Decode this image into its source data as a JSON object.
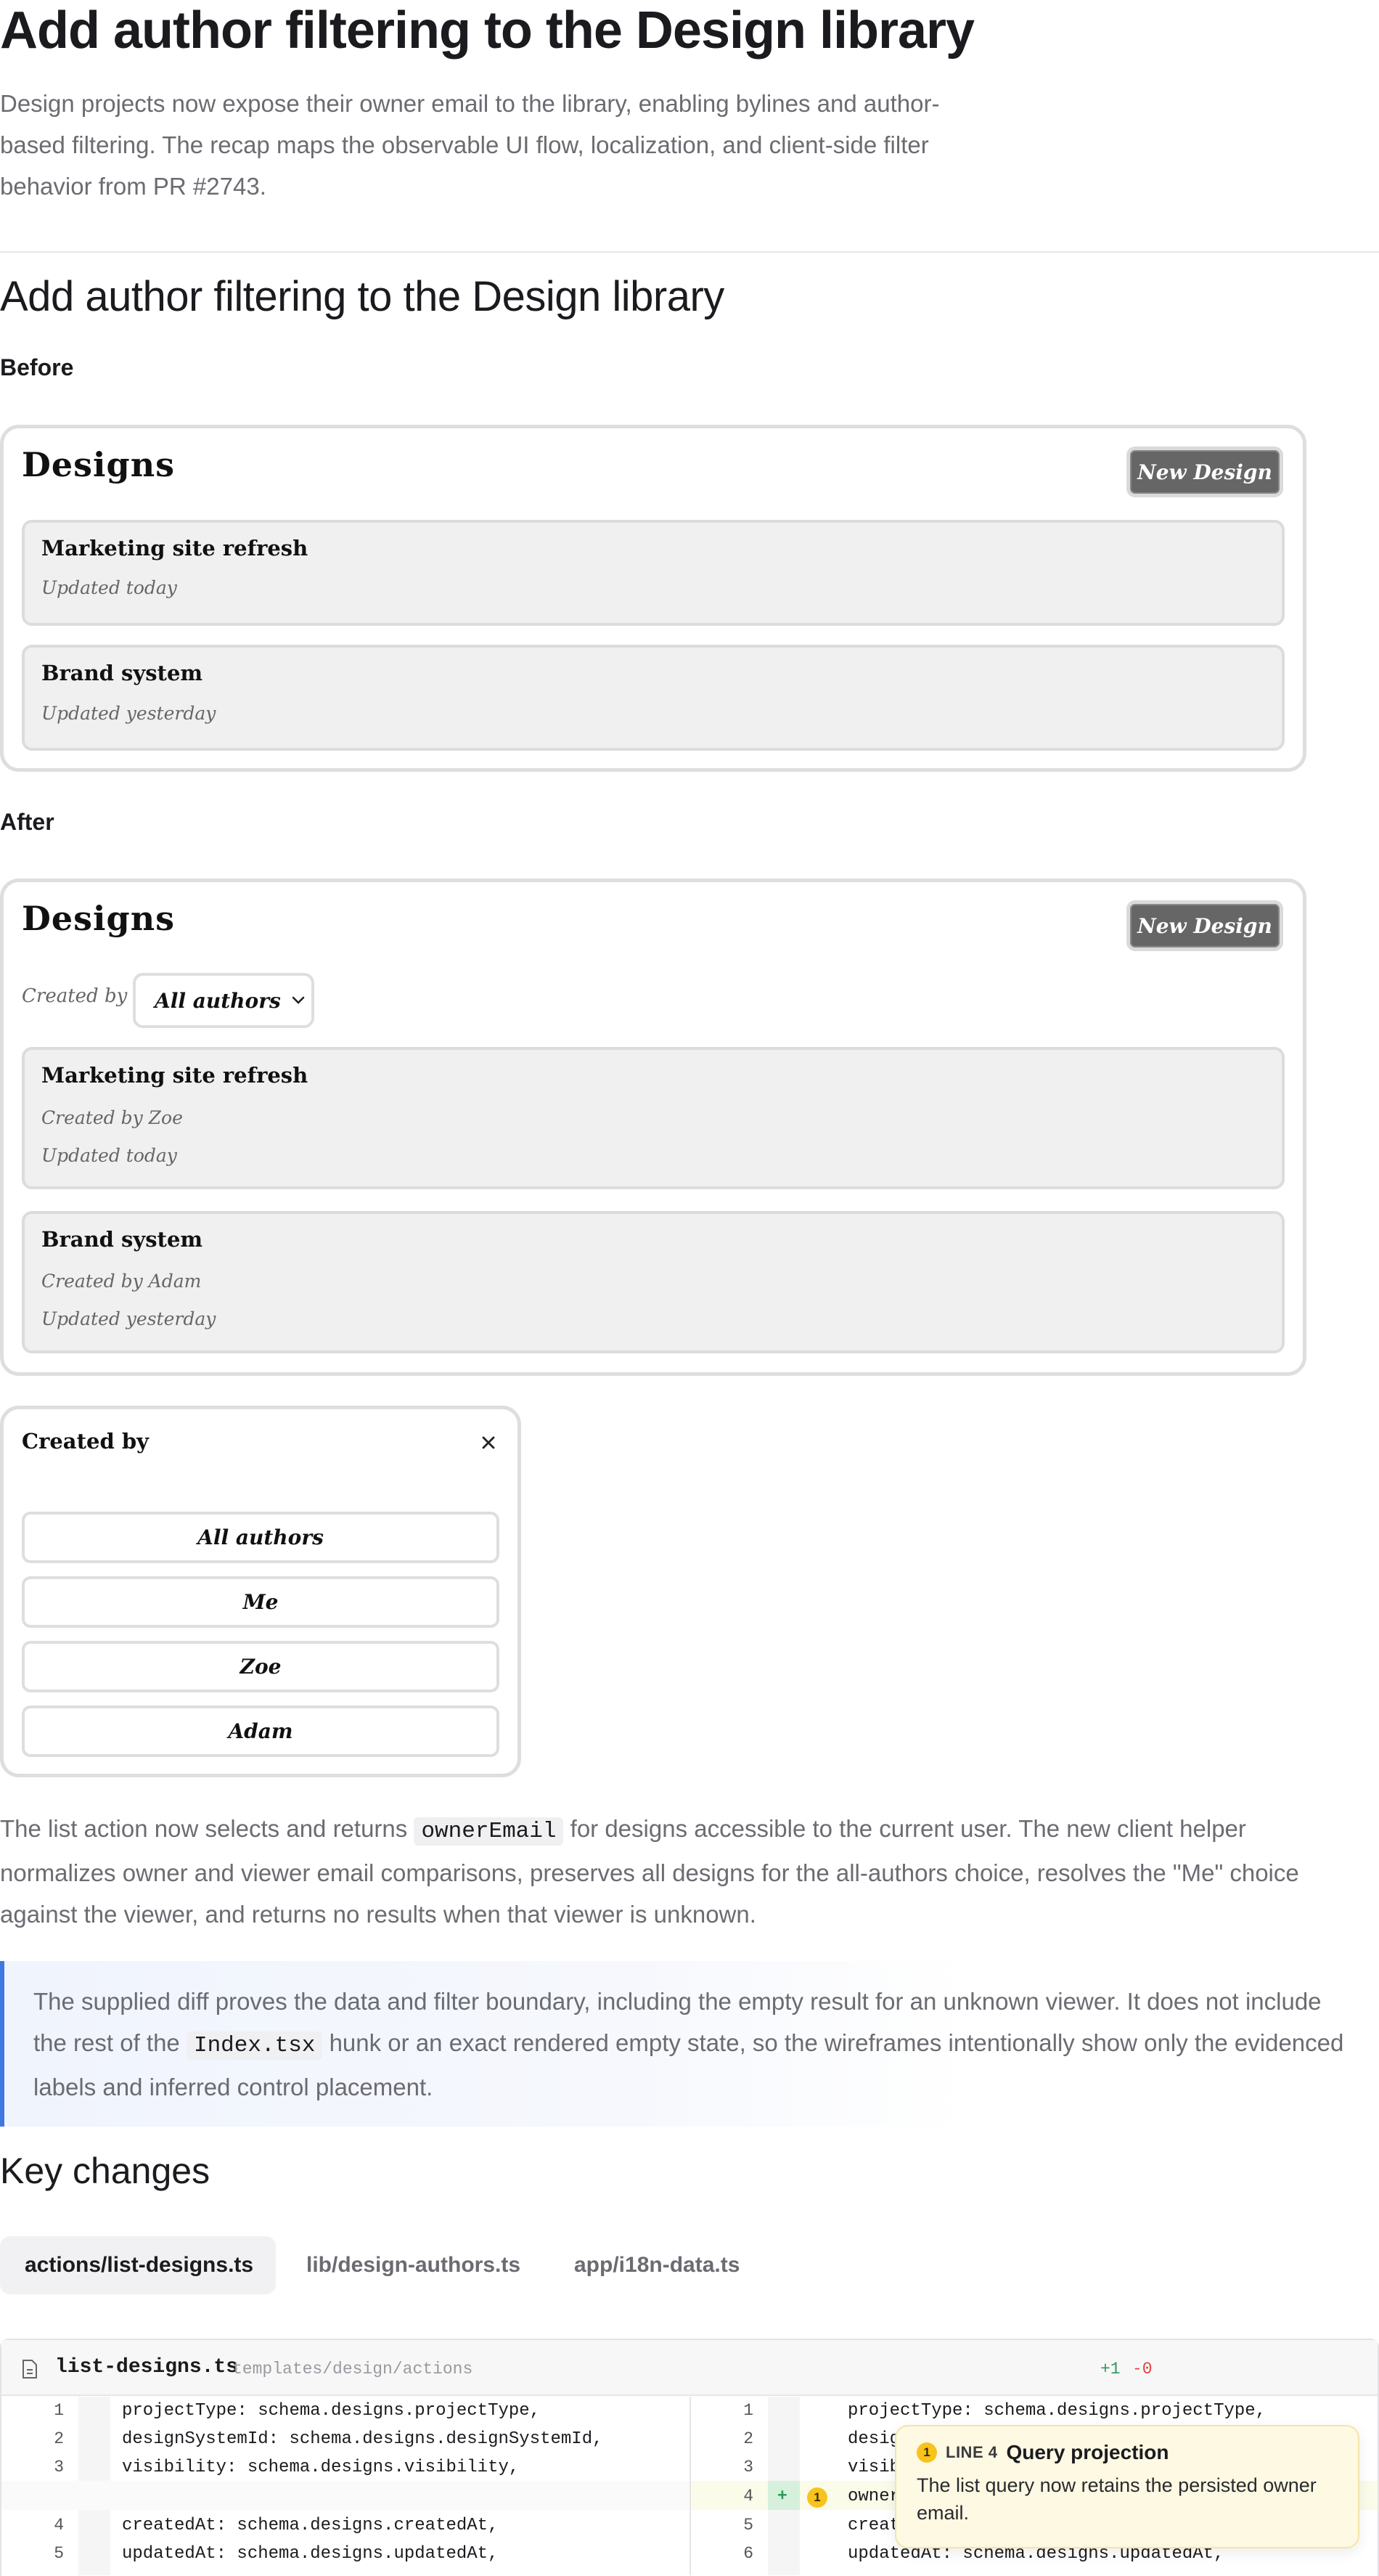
{
  "header": {
    "title": "Add author filtering to the Design library",
    "lead": "Design projects now expose their owner email to the library, enabling bylines and author-based filtering. The recap maps the observable UI flow, localization, and client-side filter behavior from PR #2743."
  },
  "section": {
    "title": "Add author filtering to the Design library",
    "before_label": "Before",
    "after_label": "After"
  },
  "before": {
    "title": "Designs",
    "new_button": "New Design",
    "items": [
      {
        "name": "Marketing site refresh",
        "updated": "Updated today"
      },
      {
        "name": "Brand system",
        "updated": "Updated yesterday"
      }
    ]
  },
  "after": {
    "title": "Designs",
    "new_button": "New Design",
    "filter_label": "Created by",
    "filter_value": "All authors",
    "items": [
      {
        "name": "Marketing site refresh",
        "created": "Created by Zoe",
        "updated": "Updated today"
      },
      {
        "name": "Brand system",
        "created": "Created by Adam",
        "updated": "Updated yesterday"
      }
    ]
  },
  "popover": {
    "title": "Created by",
    "options": [
      "All authors",
      "Me",
      "Zoe",
      "Adam"
    ]
  },
  "body": {
    "p1_before": "The list action now selects and returns ",
    "p1_code": "ownerEmail",
    "p1_after": " for designs accessible to the current user. The new client helper normalizes owner and viewer email comparisons, preserves all designs for the all-authors choice, resolves the \"Me\" choice against the viewer, and returns no results when that viewer is unknown.",
    "callout_before": "The supplied diff proves the data and filter boundary, including the empty result for an unknown viewer. It does not include the rest of the ",
    "callout_code": "Index.tsx",
    "callout_after": " hunk or an exact rendered empty state, so the wireframes intentionally show only the evidenced labels and inferred control placement."
  },
  "key_changes": {
    "title": "Key changes",
    "tabs": [
      "actions/list-designs.ts",
      "lib/design-authors.ts",
      "app/i18n-data.ts"
    ]
  },
  "diff": {
    "file": "list-designs.ts",
    "path": "templates/design/actions",
    "added": "+1",
    "removed": "-0",
    "left": [
      {
        "n": "1",
        "code": "projectType: schema.designs.projectType,"
      },
      {
        "n": "2",
        "code": "designSystemId: schema.designs.designSystemId,"
      },
      {
        "n": "3",
        "code": "visibility: schema.designs.visibility,"
      },
      {
        "n": "",
        "code": ""
      },
      {
        "n": "4",
        "code": "createdAt: schema.designs.createdAt,"
      },
      {
        "n": "5",
        "code": "updatedAt: schema.designs.updatedAt,"
      }
    ],
    "right": [
      {
        "n": "1",
        "code": "projectType: schema.designs.projectType,"
      },
      {
        "n": "2",
        "code": "desig"
      },
      {
        "n": "3",
        "code": "visib"
      },
      {
        "n": "4",
        "code": "owner",
        "mark": "+"
      },
      {
        "n": "5",
        "code": "creat"
      },
      {
        "n": "6",
        "code": "updatedAt: schema.designs.updatedAt,"
      }
    ],
    "annotation": {
      "badge": "1",
      "line": "LINE 4",
      "title": "Query projection",
      "text": "The list query now retains the persisted owner email."
    }
  },
  "colors": {
    "accent": "#3f78e0",
    "added": "#2e9a5a",
    "removed": "#e0453f",
    "annotation": "#f7c31c"
  }
}
